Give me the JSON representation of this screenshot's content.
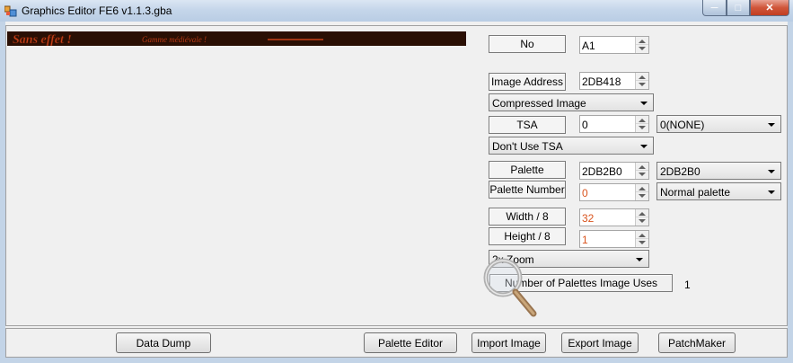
{
  "window": {
    "title": "Graphics Editor FE6 v1.1.3.gba",
    "controls": {
      "minimize": "─",
      "maximize": "□",
      "close": "✕"
    }
  },
  "preview": {
    "text_large": "Sans effet !",
    "text_small": "Gamme médiévale !"
  },
  "fields": {
    "no": {
      "label": "No",
      "value": "A1"
    },
    "image_address": {
      "label": "Image Address",
      "value": "2DB418"
    },
    "compression": {
      "selected": "Compressed Image"
    },
    "tsa": {
      "label": "TSA",
      "value": "0",
      "combo": "0(NONE)"
    },
    "tsa_mode": {
      "selected": "Don't Use TSA"
    },
    "palette": {
      "label": "Palette",
      "value": "2DB2B0",
      "combo": "2DB2B0"
    },
    "palette_number": {
      "label": "Palette Number",
      "value": "0",
      "combo": "Normal palette"
    },
    "width": {
      "label": "Width / 8",
      "value": "32"
    },
    "height": {
      "label": "Height / 8",
      "value": "1"
    },
    "zoom": {
      "selected": "2x Zoom"
    },
    "palettes_used": {
      "label": "Number of Palettes Image Uses",
      "value": "1"
    }
  },
  "buttons": {
    "data_dump": "Data Dump",
    "palette_editor": "Palette Editor",
    "import_image": "Import Image",
    "export_image": "Export Image",
    "patchmaker": "PatchMaker"
  },
  "colors": {
    "accent_orange": "#d9541e",
    "preview_bg": "#2a0f04",
    "preview_text": "#c8421a"
  },
  "icons": [
    "app-icon",
    "magnifier-icon"
  ]
}
